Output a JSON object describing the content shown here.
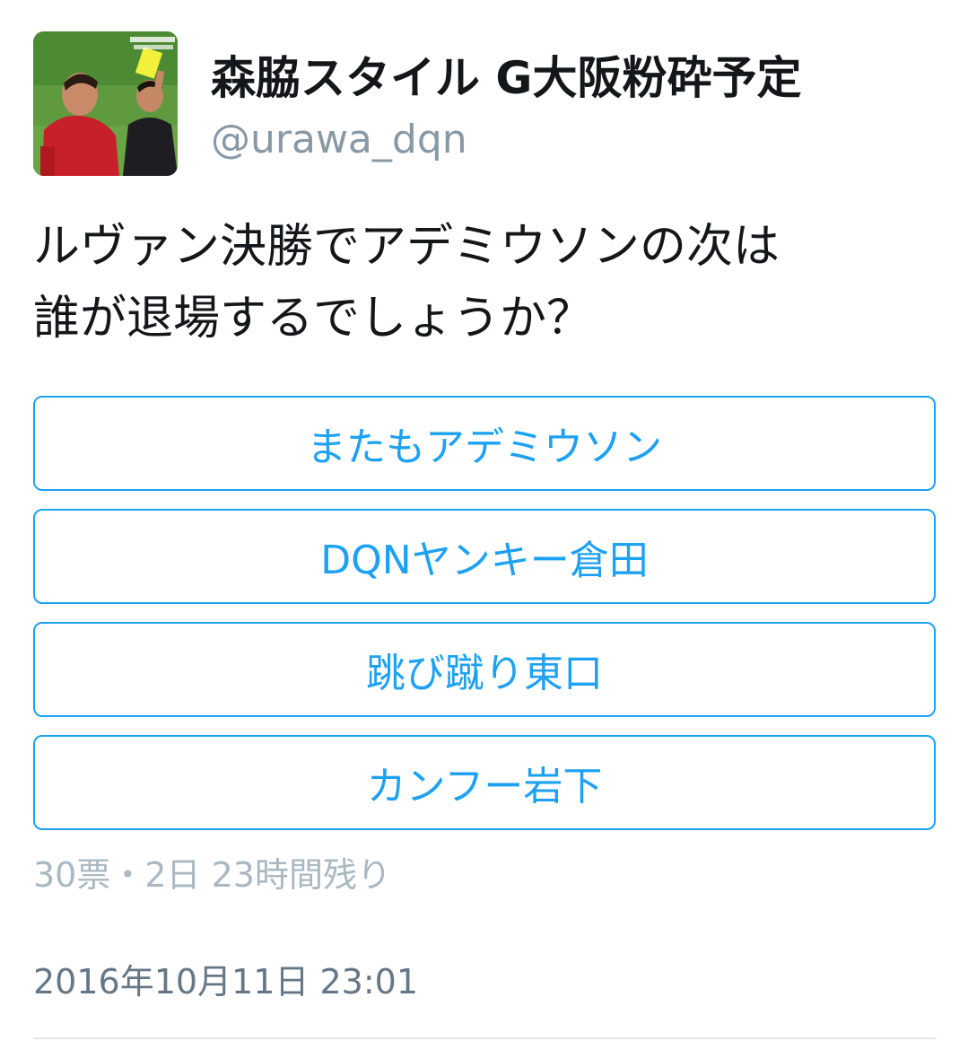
{
  "user": {
    "display_name": "森脇スタイル G大阪粉砕予定",
    "screen_name": "@urawa_dqn",
    "avatar_icon": "profile-photo-icon"
  },
  "tweet": {
    "text_line1": "ルヴァン決勝でアデミウソンの次は",
    "text_line2": "誰が退場するでしょうか？"
  },
  "poll": {
    "options": [
      {
        "label": "またもアデミウソン"
      },
      {
        "label": "DQNヤンキー倉田"
      },
      {
        "label": "跳び蹴り東口"
      },
      {
        "label": "カンフー岩下"
      }
    ],
    "meta": "30票・2日 23時間残り"
  },
  "timestamp": "2016年10月11日 23:01",
  "colors": {
    "accent": "#1da1f2",
    "text": "#14171a",
    "muted": "#8899a6"
  }
}
